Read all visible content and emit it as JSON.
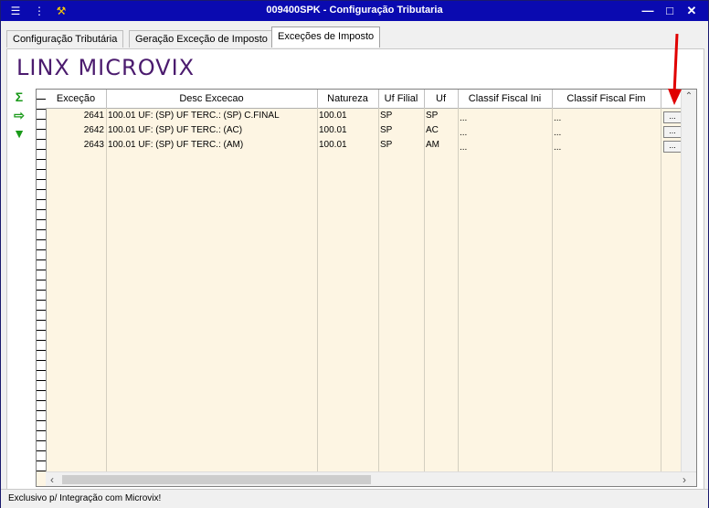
{
  "window": {
    "title": "009400SPK - Configuração Tributaria",
    "colors": {
      "titlebar": "#0a0ab0",
      "grid_bg": "#fdf5e3",
      "logo": "#4b1b6e",
      "arrow": "#e00000"
    }
  },
  "tabs": [
    {
      "label": "Configuração Tributária"
    },
    {
      "label": "Geração Exceção de Imposto"
    },
    {
      "label": "Exceções de Imposto",
      "active": true
    }
  ],
  "logo": {
    "text": "LINX MICROVIX"
  },
  "side_tools": {
    "sum_icon": "Σ",
    "export_icon": "export-icon",
    "filter_icon": "filter-icon"
  },
  "grid": {
    "columns": [
      "Exceção",
      "Desc Excecao",
      "Natureza",
      "Uf Filial",
      "Uf",
      "Classif Fiscal Ini",
      "Classif Fiscal Fim"
    ],
    "rows": [
      {
        "excecao": "2641",
        "desc": "100.01 UF: (SP) UF TERC.: (SP) C.FINAL",
        "natureza": "100.01",
        "uf_filial": "SP",
        "uf": "SP",
        "cf_ini": "...",
        "cf_fim": "...",
        "btn": "..."
      },
      {
        "excecao": "2642",
        "desc": "100.01 UF: (SP) UF TERC.: (AC)",
        "natureza": "100.01",
        "uf_filial": "SP",
        "uf": "AC",
        "cf_ini": "...",
        "cf_fim": "...",
        "btn": "..."
      },
      {
        "excecao": "2643",
        "desc": "100.01 UF: (SP) UF TERC.: (AM)",
        "natureza": "100.01",
        "uf_filial": "SP",
        "uf": "AM",
        "cf_ini": "...",
        "cf_fim": "...",
        "btn": "..."
      }
    ]
  },
  "status": {
    "text": "Exclusivo p/ Integração com Microvix!"
  }
}
